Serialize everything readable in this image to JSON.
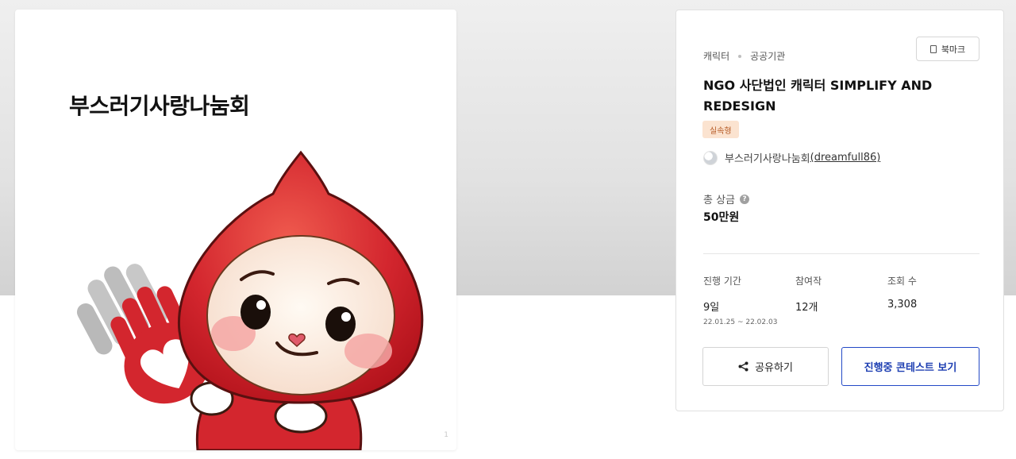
{
  "image": {
    "heading": "부스러기사랑나눔회",
    "indicator": "1"
  },
  "info": {
    "tags": [
      "캐릭터",
      "공공기관"
    ],
    "bookmark_label": "북마크",
    "title": "NGO 사단법인 캐릭터 SIMPLIFY AND REDESIGN",
    "badge": "실속형",
    "host_name": "부스러기사랑나눔회",
    "host_id": "(dreamfull86)",
    "prize_label": "총 상금",
    "prize_help": "?",
    "prize_value": "50만원",
    "stats": {
      "period": {
        "label": "진행 기간",
        "value": "9일",
        "sub": "22.01.25 ~ 22.02.03"
      },
      "entries": {
        "label": "참여작",
        "value": "12개"
      },
      "views": {
        "label": "조회 수",
        "value": "3,308"
      }
    },
    "share_label": "공유하기",
    "view_label": "진행중 콘테스트 보기"
  },
  "colors": {
    "accent": "#1e3fb2",
    "badge_bg": "#fbe3d0",
    "badge_text": "#b55a25",
    "character_red": "#d3262e"
  },
  "icons": [
    "bookmark-icon",
    "share-icon",
    "help-icon"
  ]
}
